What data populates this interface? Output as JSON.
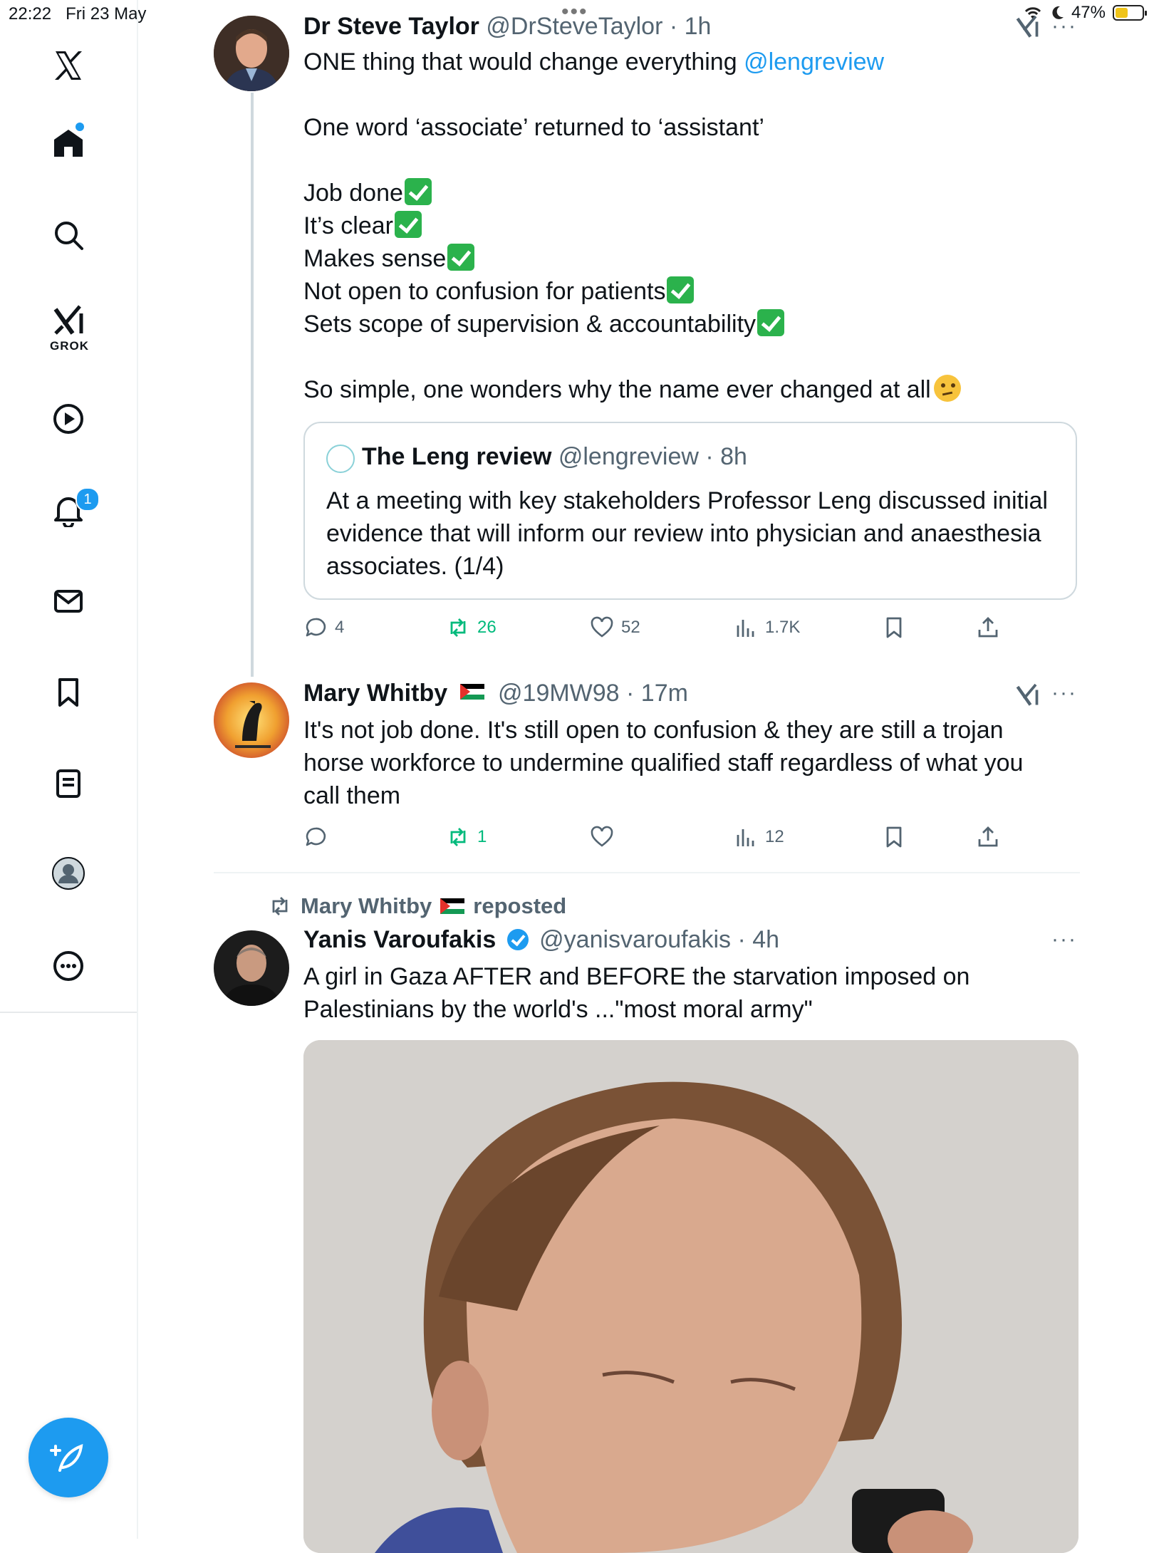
{
  "status_bar": {
    "time": "22:22",
    "date": "Fri 23 May",
    "battery": "47%",
    "battery_level": 0.47
  },
  "sidebar": {
    "grok_label": "GROK",
    "notifications_count": "1"
  },
  "thread": {
    "main": {
      "name": "Dr Steve Taylor",
      "meta": "@DrSteveTaylor · 1h",
      "lines": {
        "l1_prefix": "ONE thing that would change everything",
        "l1_link": "@lengreview",
        "l2": "One word ‘associate’ returned to ‘assistant’",
        "l3": "Job done",
        "l4": "It’s clear",
        "l5": "Makes sense",
        "l6": "Not open to confusion for patients",
        "l7": "Sets scope of supervision & accountability",
        "l8": "So simple, one wonders why the name ever changed at all"
      },
      "quote": {
        "name": "The Leng review",
        "meta": "@lengreview · 8h",
        "line1": "At a meeting with key stakeholders Professor Leng discussed initial",
        "line2": "evidence that will inform our review into physician and anaesthesia",
        "line3": "associates. (1/4)"
      },
      "stats": {
        "replies": "4",
        "reposts": "26",
        "likes": "52",
        "views": "1.7K"
      }
    },
    "reply": {
      "name": "Mary Whitby",
      "meta": "@19MW98 · 17m",
      "line1": "It's not job done. It's still open to confusion & they are still a trojan",
      "line2": "horse workforce to undermine qualified staff regardless of what you",
      "line3": "call them",
      "stats": {
        "replies": "",
        "reposts": "1",
        "likes": "",
        "views": "12"
      }
    }
  },
  "repost_item": {
    "reposter": "Mary Whitby",
    "reposted_label": "reposted",
    "name": "Yanis Varoufakis",
    "meta": "@yanisvaroufakis · 4h",
    "line1": "A girl in Gaza AFTER and BEFORE the starvation imposed on",
    "line2": "Palestinians by the world's ...\"most moral army\""
  },
  "colors": {
    "accent": "#1d9bf0",
    "repost_green": "#00ba7c",
    "muted": "#536471"
  }
}
